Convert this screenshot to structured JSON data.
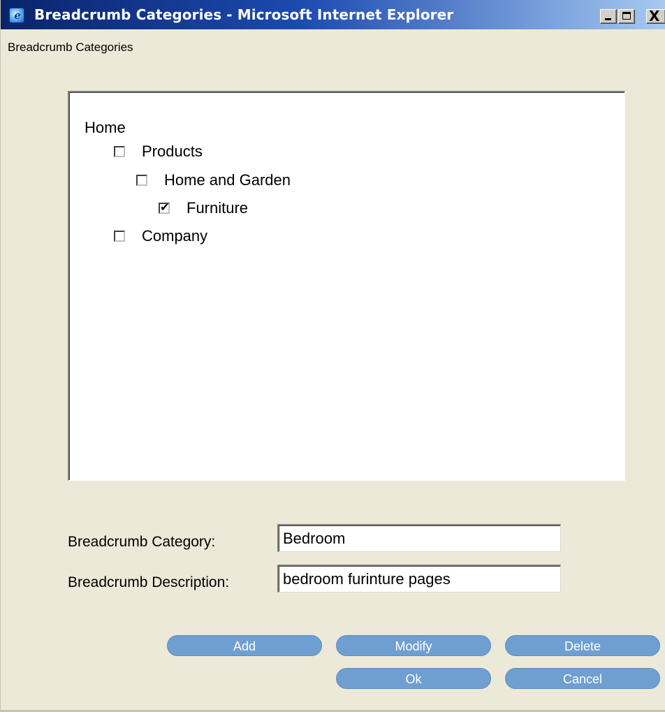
{
  "window": {
    "title": "Breadcrumb Categories - Microsoft Internet Explorer",
    "icon": "ie-icon",
    "controls": {
      "minimize": "minimize",
      "maximize": "maximize",
      "close": "X"
    }
  },
  "page": {
    "heading": "Breadcrumb Categories"
  },
  "tree": {
    "root": "Home",
    "nodes": [
      {
        "label": "Products",
        "checked": false,
        "level": 1
      },
      {
        "label": "Home and Garden",
        "checked": false,
        "level": 2
      },
      {
        "label": "Furniture",
        "checked": true,
        "level": 3
      },
      {
        "label": "Company",
        "checked": false,
        "level": 1
      }
    ]
  },
  "form": {
    "category_label": "Breadcrumb Category:",
    "category_value": "Bedroom",
    "description_label": "Breadcrumb Description:",
    "description_value": "bedroom furinture pages"
  },
  "buttons": {
    "add": "Add",
    "modify": "Modify",
    "delete": "Delete",
    "ok": "Ok",
    "cancel": "Cancel"
  },
  "colors": {
    "button_fill": "#6e9fd0",
    "title_bar": "#0a246a",
    "window_bg": "#ece9d8"
  }
}
